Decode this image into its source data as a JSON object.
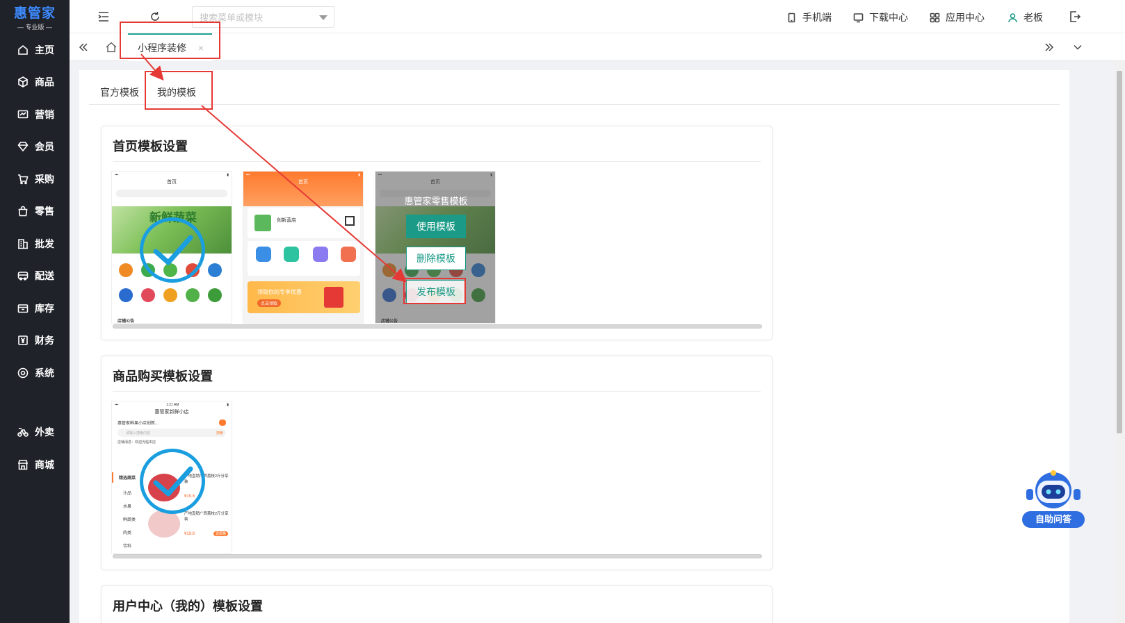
{
  "sidebar": {
    "logo_title": "惠管家",
    "logo_subtitle": "— 专业版 —",
    "items": [
      {
        "label": "主页",
        "icon": "home-icon"
      },
      {
        "label": "商品",
        "icon": "cube-icon"
      },
      {
        "label": "营销",
        "icon": "chart-icon"
      },
      {
        "label": "会员",
        "icon": "diamond-icon"
      },
      {
        "label": "采购",
        "icon": "cart-icon"
      },
      {
        "label": "零售",
        "icon": "bag-icon"
      },
      {
        "label": "批发",
        "icon": "building-icon"
      },
      {
        "label": "配送",
        "icon": "truck-icon"
      },
      {
        "label": "库存",
        "icon": "box-icon"
      },
      {
        "label": "财务",
        "icon": "yen-icon"
      },
      {
        "label": "系统",
        "icon": "settings-icon"
      },
      {
        "label": "外卖",
        "icon": "bike-icon"
      },
      {
        "label": "商城",
        "icon": "store-icon"
      }
    ]
  },
  "topbar": {
    "search_placeholder": "搜索菜单或模块",
    "links": {
      "mobile": "手机端",
      "download": "下载中心",
      "apps": "应用中心",
      "user": "老板"
    }
  },
  "tabbar": {
    "active_tab": "小程序装修",
    "close_symbol": "×"
  },
  "sub_tabs": {
    "official": "官方模板",
    "mine": "我的模板"
  },
  "sections": {
    "home": {
      "title": "首页模板设置",
      "hover_template_name": "惠管家零售模板",
      "use_button": "使用模板",
      "delete_button": "删除模板",
      "publish_button": "发布模板",
      "phone1": {
        "title": "首页",
        "banner_text": "新鲜蔬菜",
        "shop_tag": "店铺公告"
      },
      "phone2": {
        "title": "首页",
        "shop_name": "创新蓝店",
        "coupon": "领取你的专享优惠",
        "coupon_btn": "点击领取"
      },
      "phone3": {
        "title": "首页",
        "shop_tag": "店铺公告"
      }
    },
    "purchase": {
      "title": "商品购买模板设置",
      "phone": {
        "time": "1:21 AM",
        "title": "惠管家新鲜小店",
        "shop_line": "惠管家鲜果小店创新...",
        "search_placeholder": "请输入搜索内容",
        "search_btn": "搜索",
        "notice": "店铺消息：欢迎光临本店",
        "categories": [
          "精选蔬菜",
          "汁品",
          "水果",
          "鲜蔬类",
          "肉类",
          "饮料"
        ],
        "product1": "产地直销广西荔枝2斤分享装",
        "product1_price": "¥19.8",
        "product2": "产地直销广西荔枝2斤分享装",
        "product2_price": "¥19.8",
        "product2_btn": "选规格"
      }
    },
    "user_center": {
      "title": "用户中心（我的）模板设置"
    }
  },
  "assistant": {
    "label": "自助问答"
  },
  "colors": {
    "sidebar_bg": "#1f2229",
    "accent": "#1b9b87",
    "annotation_red": "#e53935",
    "check_blue": "#1a9ee0"
  }
}
